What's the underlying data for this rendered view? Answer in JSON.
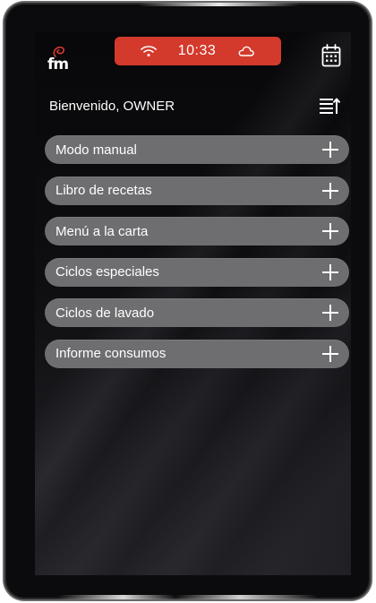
{
  "status_bar": {
    "time": "10:33",
    "color": "#d33a2c",
    "wifi_icon": "wifi-icon",
    "cloud_icon": "cloud-icon"
  },
  "header": {
    "logo_text": "fm",
    "welcome": "Bienvenido, OWNER",
    "calendar_icon": "calendar-icon",
    "sort_icon": "sort-list-icon"
  },
  "menu": {
    "items": [
      {
        "label": "Modo manual",
        "icon": "plus-icon"
      },
      {
        "label": "Libro de recetas",
        "icon": "plus-icon"
      },
      {
        "label": "Menú a la carta",
        "icon": "plus-icon"
      },
      {
        "label": "Ciclos especiales",
        "icon": "plus-icon"
      },
      {
        "label": "Ciclos de lavado",
        "icon": "plus-icon"
      },
      {
        "label": "Informe consumos",
        "icon": "plus-icon"
      }
    ]
  }
}
